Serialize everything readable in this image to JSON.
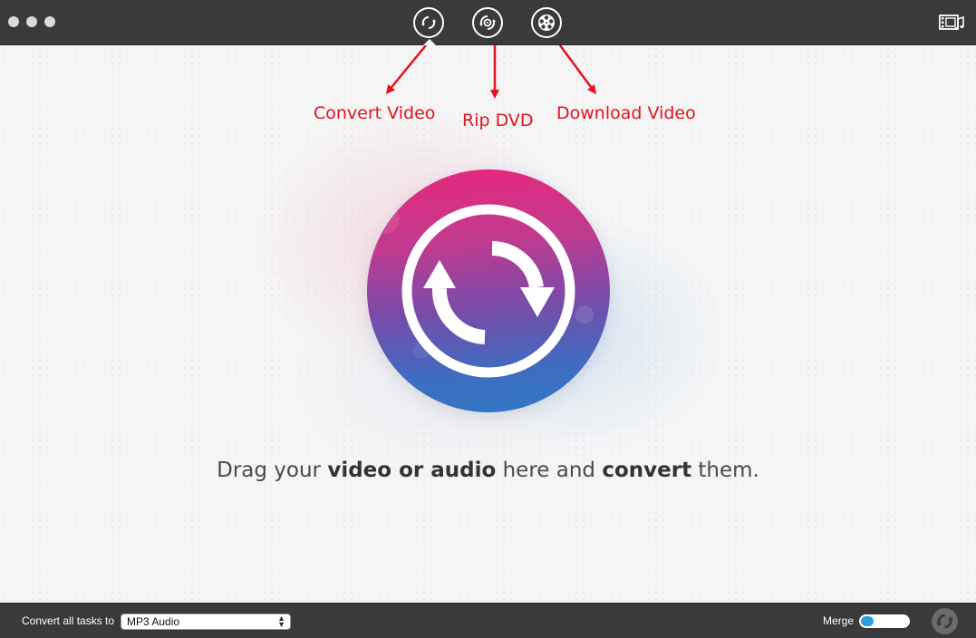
{
  "toolbar": {
    "convert_video_icon": "convert-arrows-icon",
    "rip_dvd_icon": "disc-convert-icon",
    "download_video_icon": "film-reel-download-icon",
    "media_browser_icon": "film-music-icon"
  },
  "annotations": {
    "convert_video": "Convert Video",
    "rip_dvd": "Rip DVD",
    "download_video": "Download Video",
    "color": "#e0141e"
  },
  "main": {
    "drop_text_prefix": "Drag your ",
    "drop_text_bold1": "video or audio",
    "drop_text_middle": " here and ",
    "drop_text_bold2": "convert",
    "drop_text_suffix": " them.",
    "big_icon": "convert-arrows-icon"
  },
  "bottom": {
    "convert_all_label": "Convert all tasks to",
    "format_selected": "MP3 Audio",
    "merge_label": "Merge",
    "merge_on": false,
    "toggle_color": "#2a9fe0",
    "run_icon": "convert-arrows-icon"
  },
  "colors": {
    "titlebar": "#3a3a3a",
    "gradient_top": "#e8267a",
    "gradient_bottom": "#2f7ac4"
  }
}
